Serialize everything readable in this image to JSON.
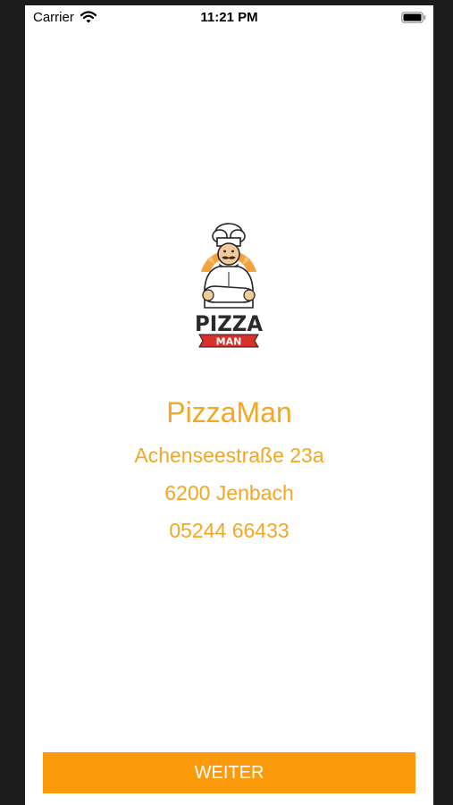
{
  "status_bar": {
    "carrier": "Carrier",
    "time": "11:21 PM",
    "wifi_icon": "wifi-icon",
    "battery_icon": "battery-icon"
  },
  "logo": {
    "icon": "pizza-man-chef-logo",
    "word_top": "PIZZA",
    "word_bottom": "MAN"
  },
  "restaurant": {
    "name": "PizzaMan",
    "street": "Achenseestraße 23a",
    "city": "6200 Jenbach",
    "phone": "05244 66433"
  },
  "actions": {
    "continue_label": "WEITER"
  },
  "colors": {
    "accent_text": "#f5a623",
    "button_bg": "#fb9a0a",
    "button_text": "#ffffff"
  }
}
